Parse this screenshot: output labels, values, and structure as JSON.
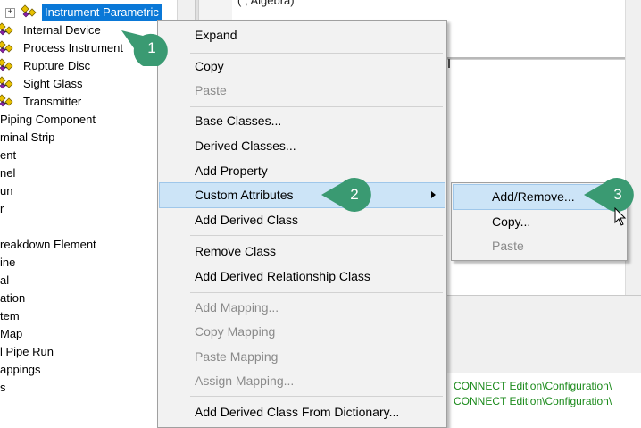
{
  "tree": {
    "selected_label": "Instrument Parametric",
    "items": [
      {
        "label": "Internal Device"
      },
      {
        "label": "Process Instrument"
      },
      {
        "label": "Rupture Disc"
      },
      {
        "label": "Sight Glass"
      },
      {
        "label": "Transmitter"
      }
    ],
    "clipped_items": [
      "Piping Component",
      "minal Strip",
      "ent",
      "nel",
      "un",
      "r",
      "",
      "reakdown Element",
      "ine",
      "al",
      "ation",
      "tem",
      " Map",
      "l Pipe Run",
      "appings",
      "s"
    ]
  },
  "top_strip_text": "(                , Algebra)",
  "context_menu": {
    "items": [
      {
        "label": "Expand",
        "disabled": false
      },
      {
        "label": "Copy",
        "disabled": false
      },
      {
        "label": "Paste",
        "disabled": true
      },
      {
        "label": "Base Classes...",
        "disabled": false
      },
      {
        "label": "Derived Classes...",
        "disabled": false
      },
      {
        "label": "Add Property",
        "disabled": false
      },
      {
        "label": "Custom Attributes",
        "disabled": false
      },
      {
        "label": "Add Derived Class",
        "disabled": false
      },
      {
        "label": "Remove Class",
        "disabled": false
      },
      {
        "label": "Add Derived Relationship Class",
        "disabled": false
      },
      {
        "label": "Add Mapping...",
        "disabled": true
      },
      {
        "label": "Copy Mapping",
        "disabled": true
      },
      {
        "label": "Paste Mapping",
        "disabled": true
      },
      {
        "label": "Assign Mapping...",
        "disabled": true
      },
      {
        "label": "Add Derived Class From Dictionary...",
        "disabled": false
      }
    ]
  },
  "submenu": {
    "items": [
      {
        "label": "Add/Remove...",
        "disabled": false
      },
      {
        "label": "Copy...",
        "disabled": false
      },
      {
        "label": "Paste",
        "disabled": true
      }
    ]
  },
  "output": {
    "lines": [
      "CONNECT Edition\\Configuration\\",
      "CONNECT Edition\\Configuration\\"
    ]
  },
  "callouts": [
    {
      "label": "1"
    },
    {
      "label": "2"
    },
    {
      "label": "3"
    }
  ],
  "colors": {
    "callout": "#3a9a72",
    "selection": "#0a78d7",
    "menu_highlight": "#cce4f7",
    "output_text": "#1b8a1b"
  }
}
